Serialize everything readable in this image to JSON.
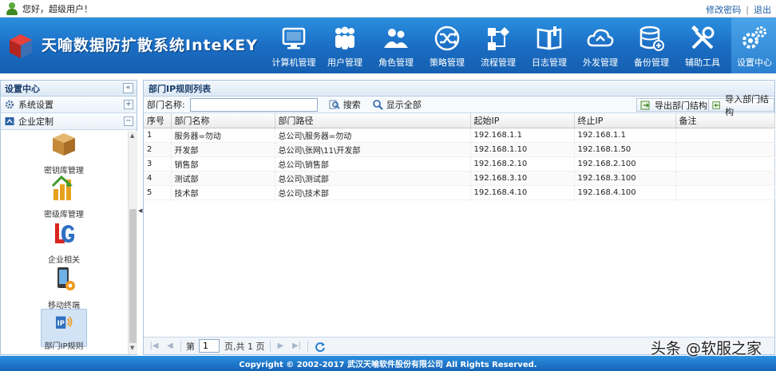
{
  "topbar": {
    "greeting": "您好，超级用户！",
    "change_password": "修改密码",
    "separator": "|",
    "logout": "退出"
  },
  "header": {
    "title": "天喻数据防扩散系统InteKEY",
    "nav": [
      {
        "label": "计算机管理",
        "icon": "monitor-icon"
      },
      {
        "label": "用户管理",
        "icon": "users-icon"
      },
      {
        "label": "角色管理",
        "icon": "roles-icon"
      },
      {
        "label": "策略管理",
        "icon": "shuffle-icon"
      },
      {
        "label": "流程管理",
        "icon": "flowchart-icon"
      },
      {
        "label": "日志管理",
        "icon": "book-icon"
      },
      {
        "label": "外发管理",
        "icon": "cloud-icon"
      },
      {
        "label": "备份管理",
        "icon": "database-icon"
      },
      {
        "label": "辅助工具",
        "icon": "tools-icon"
      },
      {
        "label": "设置中心",
        "icon": "gears-icon",
        "active": true
      }
    ]
  },
  "left_panel": {
    "title": "设置中心",
    "collapse_glyph": "«",
    "sections": [
      {
        "label": "系统设置",
        "toggle": "+"
      },
      {
        "label": "企业定制",
        "toggle": "−"
      }
    ],
    "modules": [
      {
        "label": "密钥库管理",
        "icon": "box-icon"
      },
      {
        "label": "密级库管理",
        "icon": "level-bars-icon"
      },
      {
        "label": "企业相关",
        "icon": "enterprise-logo-icon"
      },
      {
        "label": "移动终端",
        "icon": "mobile-device-icon"
      },
      {
        "label": "部门IP规则",
        "icon": "ip-rule-icon",
        "active": true
      }
    ]
  },
  "right_panel": {
    "title": "部门IP规则列表",
    "toolbar": {
      "dept_name_label": "部门名称:",
      "dept_name_value": "",
      "search": "搜索",
      "show_all": "显示全部",
      "export": "导出部门结构",
      "import": "导入部门结构"
    },
    "table": {
      "headers": [
        "序号",
        "部门名称",
        "部门路径",
        "起始IP",
        "终止IP",
        "备注"
      ],
      "rows": [
        [
          "1",
          "服务器=勿动",
          "总公司\\服务器=勿动",
          "192.168.1.1",
          "192.168.1.1",
          ""
        ],
        [
          "2",
          "开发部",
          "总公司\\张网\\11\\开发部",
          "192.168.1.10",
          "192.168.1.50",
          ""
        ],
        [
          "3",
          "销售部",
          "总公司\\销售部",
          "192.168.2.10",
          "192.168.2.100",
          ""
        ],
        [
          "4",
          "测试部",
          "总公司\\测试部",
          "192.168.3.10",
          "192.168.3.100",
          ""
        ],
        [
          "5",
          "技术部",
          "总公司\\技术部",
          "192.168.4.10",
          "192.168.4.100",
          ""
        ]
      ]
    },
    "pager": {
      "page_prefix": "第",
      "page_value": "1",
      "page_suffix": "页,共 1 页"
    }
  },
  "footer": {
    "copyright": "Copyright © 2002-2017 武汉天喻软件股份有限公司 All Rights Reserved."
  },
  "watermark": "头条 @软服之家",
  "colors": {
    "header_blue": "#1a6cc2",
    "link_blue": "#1e5fa8",
    "panel_border": "#a9c4e0"
  }
}
